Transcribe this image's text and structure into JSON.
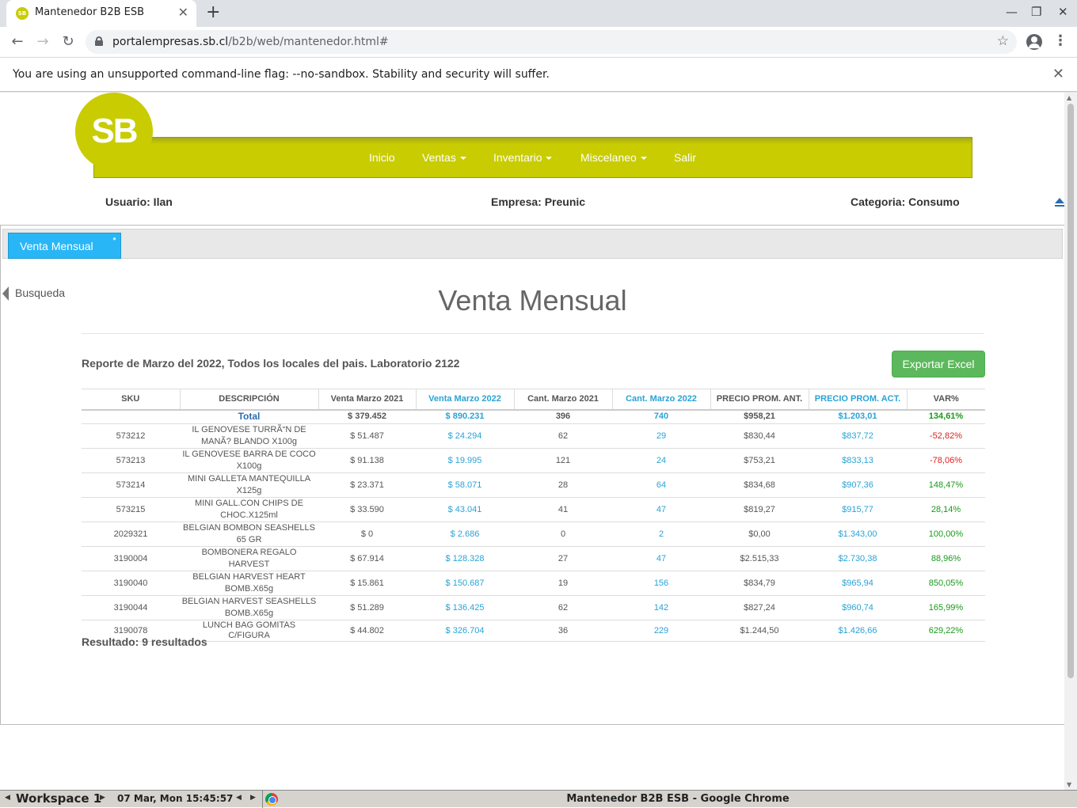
{
  "browser": {
    "tab_title": "Mantenedor B2B ESB",
    "tab_favicon_text": "SB",
    "url_host": "portalempresas.sb.cl",
    "url_path": "/b2b/web/mantenedor.html#",
    "infobar_message": "You are using an unsupported command-line flag: --no-sandbox. Stability and security will suffer."
  },
  "site": {
    "logo_text": "SB",
    "brand_color": "#c8cc00",
    "nav": [
      {
        "label": "Inicio",
        "dropdown": false
      },
      {
        "label": "Ventas",
        "dropdown": true
      },
      {
        "label": "Inventario",
        "dropdown": true
      },
      {
        "label": "Miscelaneo",
        "dropdown": true
      },
      {
        "label": "Salir",
        "dropdown": false
      }
    ],
    "user": "Usuario: Ilan",
    "company": "Empresa: Preunic",
    "category": "Categoria: Consumo"
  },
  "workspace": {
    "tab_label": "Venta Mensual",
    "search_toggle": "Busqueda",
    "heading": "Venta Mensual",
    "report_description": "Reporte de Marzo del 2022, Todos los locales del pais. Laboratorio 2122",
    "export_button": "Exportar Excel",
    "result_count": "Resultado: 9 resultados"
  },
  "table": {
    "headers": [
      "SKU",
      "DESCRIPCIÓN",
      "Venta Marzo 2021",
      "Venta Marzo 2022",
      "Cant. Marzo 2021",
      "Cant. Marzo 2022",
      "PRECIO PROM. ANT.",
      "PRECIO PROM. ACT.",
      "VAR%"
    ],
    "total": {
      "label": "Total",
      "venta_2021": "$ 379.452",
      "venta_2022": "$ 890.231",
      "cant_2021": "396",
      "cant_2022": "740",
      "precio_ant": "$958,21",
      "precio_act": "$1.203,01",
      "var": "134,61%"
    },
    "rows": [
      {
        "sku": "573212",
        "desc": "IL GENOVESE TURRÃ“N DE MANÃ? BLANDO X100g",
        "venta_2021": "$ 51.487",
        "venta_2022": "$ 24.294",
        "cant_2021": "62",
        "cant_2022": "29",
        "precio_ant": "$830,44",
        "precio_act": "$837,72",
        "var": "-52,82%",
        "trend": "down"
      },
      {
        "sku": "573213",
        "desc": "IL GENOVESE BARRA DE COCO X100g",
        "venta_2021": "$ 91.138",
        "venta_2022": "$ 19.995",
        "cant_2021": "121",
        "cant_2022": "24",
        "precio_ant": "$753,21",
        "precio_act": "$833,13",
        "var": "-78,06%",
        "trend": "down"
      },
      {
        "sku": "573214",
        "desc": "MINI GALLETA MANTEQUILLA X125g",
        "venta_2021": "$ 23.371",
        "venta_2022": "$ 58.071",
        "cant_2021": "28",
        "cant_2022": "64",
        "precio_ant": "$834,68",
        "precio_act": "$907,36",
        "var": "148,47%",
        "trend": "up"
      },
      {
        "sku": "573215",
        "desc": "MINI GALL.CON CHIPS DE CHOC.X125ml",
        "venta_2021": "$ 33.590",
        "venta_2022": "$ 43.041",
        "cant_2021": "41",
        "cant_2022": "47",
        "precio_ant": "$819,27",
        "precio_act": "$915,77",
        "var": "28,14%",
        "trend": "up"
      },
      {
        "sku": "2029321",
        "desc": "BELGIAN BOMBON SEASHELLS 65 GR",
        "venta_2021": "$ 0",
        "venta_2022": "$ 2.686",
        "cant_2021": "0",
        "cant_2022": "2",
        "precio_ant": "$0,00",
        "precio_act": "$1.343,00",
        "var": "100,00%",
        "trend": "up"
      },
      {
        "sku": "3190004",
        "desc": "BOMBONERA REGALO HARVEST",
        "venta_2021": "$ 67.914",
        "venta_2022": "$ 128.328",
        "cant_2021": "27",
        "cant_2022": "47",
        "precio_ant": "$2.515,33",
        "precio_act": "$2.730,38",
        "var": "88,96%",
        "trend": "up"
      },
      {
        "sku": "3190040",
        "desc": "BELGIAN HARVEST HEART BOMB.X65g",
        "venta_2021": "$ 15.861",
        "venta_2022": "$ 150.687",
        "cant_2021": "19",
        "cant_2022": "156",
        "precio_ant": "$834,79",
        "precio_act": "$965,94",
        "var": "850,05%",
        "trend": "up"
      },
      {
        "sku": "3190044",
        "desc": "BELGIAN HARVEST SEASHELLS BOMB.X65g",
        "venta_2021": "$ 51.289",
        "venta_2022": "$ 136.425",
        "cant_2021": "62",
        "cant_2022": "142",
        "precio_ant": "$827,24",
        "precio_act": "$960,74",
        "var": "165,99%",
        "trend": "up"
      },
      {
        "sku": "3190078",
        "desc": "LUNCH BAG GOMITAS C/FIGURA",
        "venta_2021": "$ 44.802",
        "venta_2022": "$ 326.704",
        "cant_2021": "36",
        "cant_2022": "229",
        "precio_ant": "$1.244,50",
        "precio_act": "$1.426,66",
        "var": "629,22%",
        "trend": "up"
      }
    ]
  },
  "taskbar": {
    "workspace": "Workspace 1",
    "clock": "07 Mar, Mon 15:45:57",
    "window_title": "Mantenedor B2B ESB - Google Chrome"
  }
}
